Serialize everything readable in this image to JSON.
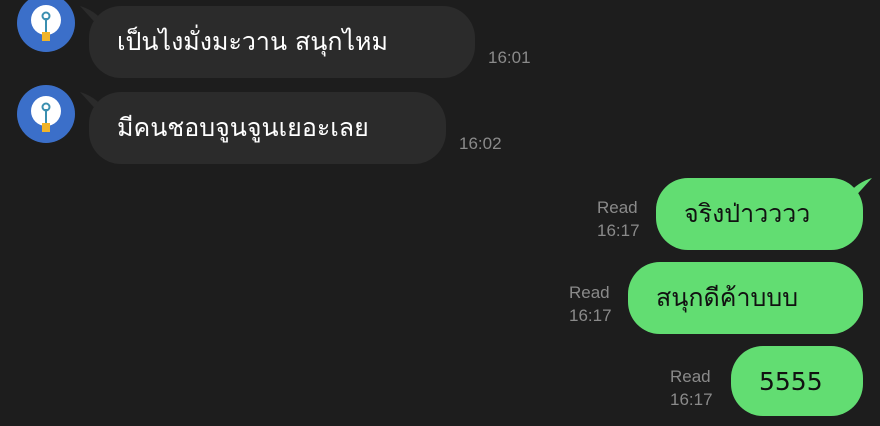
{
  "theme": {
    "background": "#1d1d1d",
    "incoming_bubble": "#2b2b2b",
    "outgoing_bubble": "#62dd72",
    "avatar_bg": "#3b6fc9",
    "meta_text": "#8a8a8a"
  },
  "messages_in": [
    {
      "text": "เป็นไงมั่งมะวาน สนุกไหม",
      "time": "16:01",
      "avatar_icon": "lightbulb-icon"
    },
    {
      "text": "มีคนชอบจูนจูนเยอะเลย",
      "time": "16:02",
      "avatar_icon": "lightbulb-icon"
    }
  ],
  "messages_out": [
    {
      "text": "จริงป่าวววว",
      "status": "Read",
      "time": "16:17"
    },
    {
      "text": "สนุกดีค้าบบบ",
      "status": "Read",
      "time": "16:17"
    },
    {
      "text": "5555",
      "status": "Read",
      "time": "16:17"
    }
  ]
}
